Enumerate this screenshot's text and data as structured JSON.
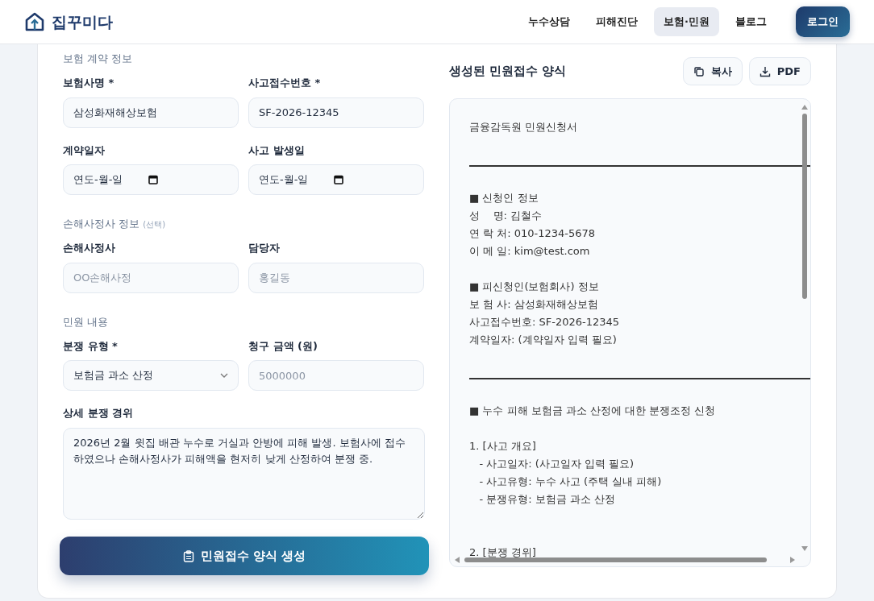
{
  "brand": {
    "name": "집꾸미다"
  },
  "nav": [
    {
      "label": "누수상담",
      "selected": false
    },
    {
      "label": "피해진단",
      "selected": false
    },
    {
      "label": "보험·민원",
      "selected": true
    },
    {
      "label": "블로그",
      "selected": false
    }
  ],
  "login": {
    "label": "로그인"
  },
  "form": {
    "sections": [
      {
        "title": "보험 계약 정보",
        "fields": [
          {
            "label": "보험사명 *",
            "kind": "text",
            "value": "삼성화재해상보험"
          },
          {
            "label": "사고접수번호 *",
            "kind": "text",
            "value": "SF-2026-12345"
          },
          {
            "label": "계약일자",
            "kind": "date",
            "value": "연도-월-일"
          },
          {
            "label": "사고 발생일",
            "kind": "date",
            "value": "연도-월-일"
          }
        ]
      },
      {
        "title": "손해사정사 정보",
        "note": "(선택)",
        "fields": [
          {
            "label": "손해사정사",
            "kind": "text",
            "placeholder": "OO손해사정"
          },
          {
            "label": "담당자",
            "kind": "text",
            "placeholder": "홍길동"
          }
        ]
      },
      {
        "title": "민원 내용",
        "fields": [
          {
            "label": "분쟁 유형 *",
            "kind": "select",
            "value": "보험금 과소 산정"
          },
          {
            "label": "청구 금액 (원)",
            "kind": "text",
            "placeholder": "5000000"
          },
          {
            "label": "상세 분쟁 경위",
            "kind": "textarea",
            "value": "2026년 2월 윗집 배관 누수로 거실과 안방에 피해 발생. 보험사에 접수하였으나 손해사정사가 피해액을 현저히 낮게 산정하여 분쟁 중."
          }
        ]
      }
    ],
    "submit": "민원접수 양식 생성"
  },
  "output": {
    "title": "생성된 민원접수 양식",
    "copy": "복사",
    "pdf": "PDF",
    "lines": [
      {
        "kind": "text",
        "text": "금융감독원 민원신청서"
      },
      {
        "kind": "blank"
      },
      {
        "kind": "rule"
      },
      {
        "kind": "blank"
      },
      {
        "kind": "text",
        "text": "■ 신청인 정보"
      },
      {
        "kind": "text",
        "text": "성    명: 김철수"
      },
      {
        "kind": "text",
        "text": "연 락 처: 010-1234-5678"
      },
      {
        "kind": "text",
        "text": "이 메 일: kim@test.com"
      },
      {
        "kind": "blank"
      },
      {
        "kind": "text",
        "text": "■ 피신청인(보험회사) 정보"
      },
      {
        "kind": "text",
        "text": "보 험 사: 삼성화재해상보험"
      },
      {
        "kind": "text",
        "text": "사고접수번호: SF-2026-12345"
      },
      {
        "kind": "text",
        "text": "계약일자: (계약일자 입력 필요)"
      },
      {
        "kind": "blank"
      },
      {
        "kind": "rule"
      },
      {
        "kind": "blank"
      },
      {
        "kind": "text",
        "text": "■ 누수 피해 보험금 과소 산정에 대한 분쟁조정 신청"
      },
      {
        "kind": "blank"
      },
      {
        "kind": "text",
        "text": "1. [사고 개요]"
      },
      {
        "kind": "text",
        "text": "   - 사고일자: (사고일자 입력 필요)"
      },
      {
        "kind": "text",
        "text": "   - 사고유형: 누수 사고 (주택 실내 피해)"
      },
      {
        "kind": "text",
        "text": "   - 분쟁유형: 보험금 과소 산정"
      },
      {
        "kind": "blank"
      },
      {
        "kind": "blank"
      },
      {
        "kind": "text",
        "text": "2. [분쟁 경위]"
      }
    ]
  }
}
